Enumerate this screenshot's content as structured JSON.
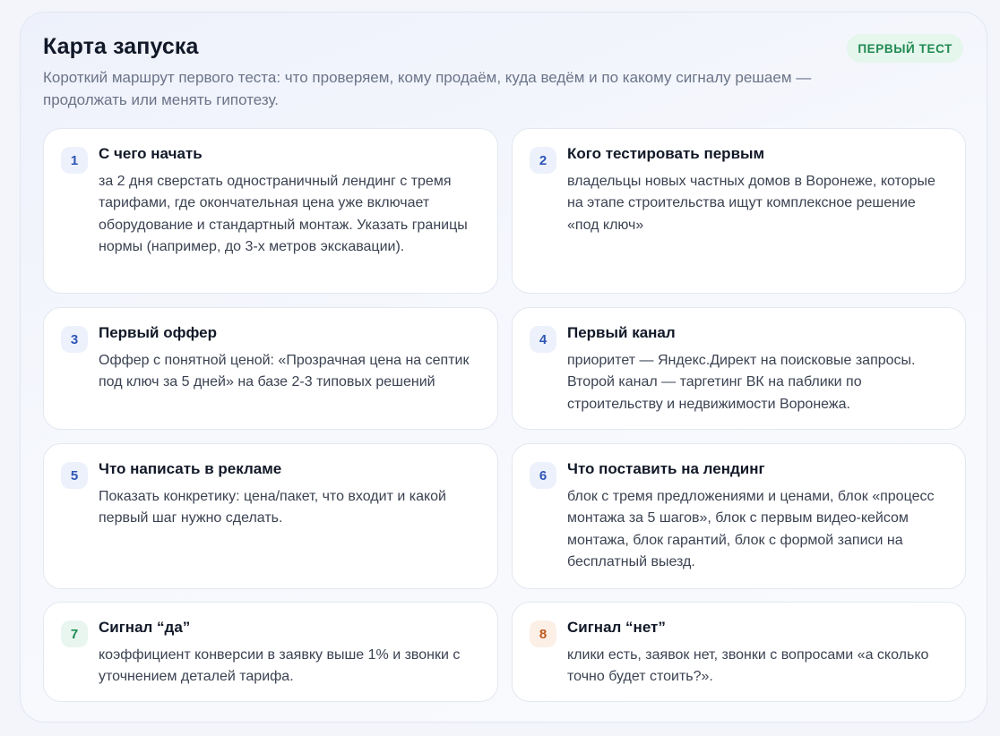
{
  "header": {
    "title": "Карта запуска",
    "badge": "ПЕРВЫЙ ТЕСТ",
    "subtitle": "Короткий маршрут первого теста: что проверяем, кому продаём, куда ведём и по какому сигналу решаем — продолжать или менять гипотезу."
  },
  "cards": [
    {
      "number": "1",
      "title": "С чего начать",
      "text": "за 2 дня сверстать одностраничный лендинг с тремя тарифами, где окончательная цена уже включает оборудование и стандартный монтаж. Указать границы нормы (например, до 3-х метров экскавации).",
      "accent": "blue"
    },
    {
      "number": "2",
      "title": "Кого тестировать первым",
      "text": "владельцы новых частных домов в Воронеже, которые на этапе строительства ищут комплексное решение «под ключ»",
      "accent": "blue"
    },
    {
      "number": "3",
      "title": "Первый оффер",
      "text": "Оффер с понятной ценой: «Прозрачная цена на септик под ключ за 5 дней» на базе 2-3 типовых решений",
      "accent": "blue"
    },
    {
      "number": "4",
      "title": "Первый канал",
      "text": "приоритет — Яндекс.Директ на поисковые запросы. Второй канал — таргетинг ВК на паблики по строительству и недвижимости Воронежа.",
      "accent": "blue"
    },
    {
      "number": "5",
      "title": "Что написать в рекламе",
      "text": "Показать конкретику: цена/пакет, что входит и какой первый шаг нужно сделать.",
      "accent": "blue"
    },
    {
      "number": "6",
      "title": "Что поставить на лендинг",
      "text": "блок с тремя предложениями и ценами, блок «процесс монтажа за 5 шагов», блок с первым видео-кейсом монтажа, блок гарантий, блок с формой записи на бесплатный выезд.",
      "accent": "blue"
    },
    {
      "number": "7",
      "title": "Сигнал “да”",
      "text": "коэффициент конверсии в заявку выше 1% и звонки с уточнением деталей тарифа.",
      "accent": "green"
    },
    {
      "number": "8",
      "title": "Сигнал “нет”",
      "text": "клики есть, заявок нет, звонки с вопросами «а сколько точно будет стоить?».",
      "accent": "orange"
    }
  ],
  "colors": {
    "badge_bg": "#e5f6ec",
    "badge_text": "#1f8a52",
    "number_blue": "#2f56b6",
    "number_green": "#1f8a52",
    "number_orange": "#c2581c"
  }
}
